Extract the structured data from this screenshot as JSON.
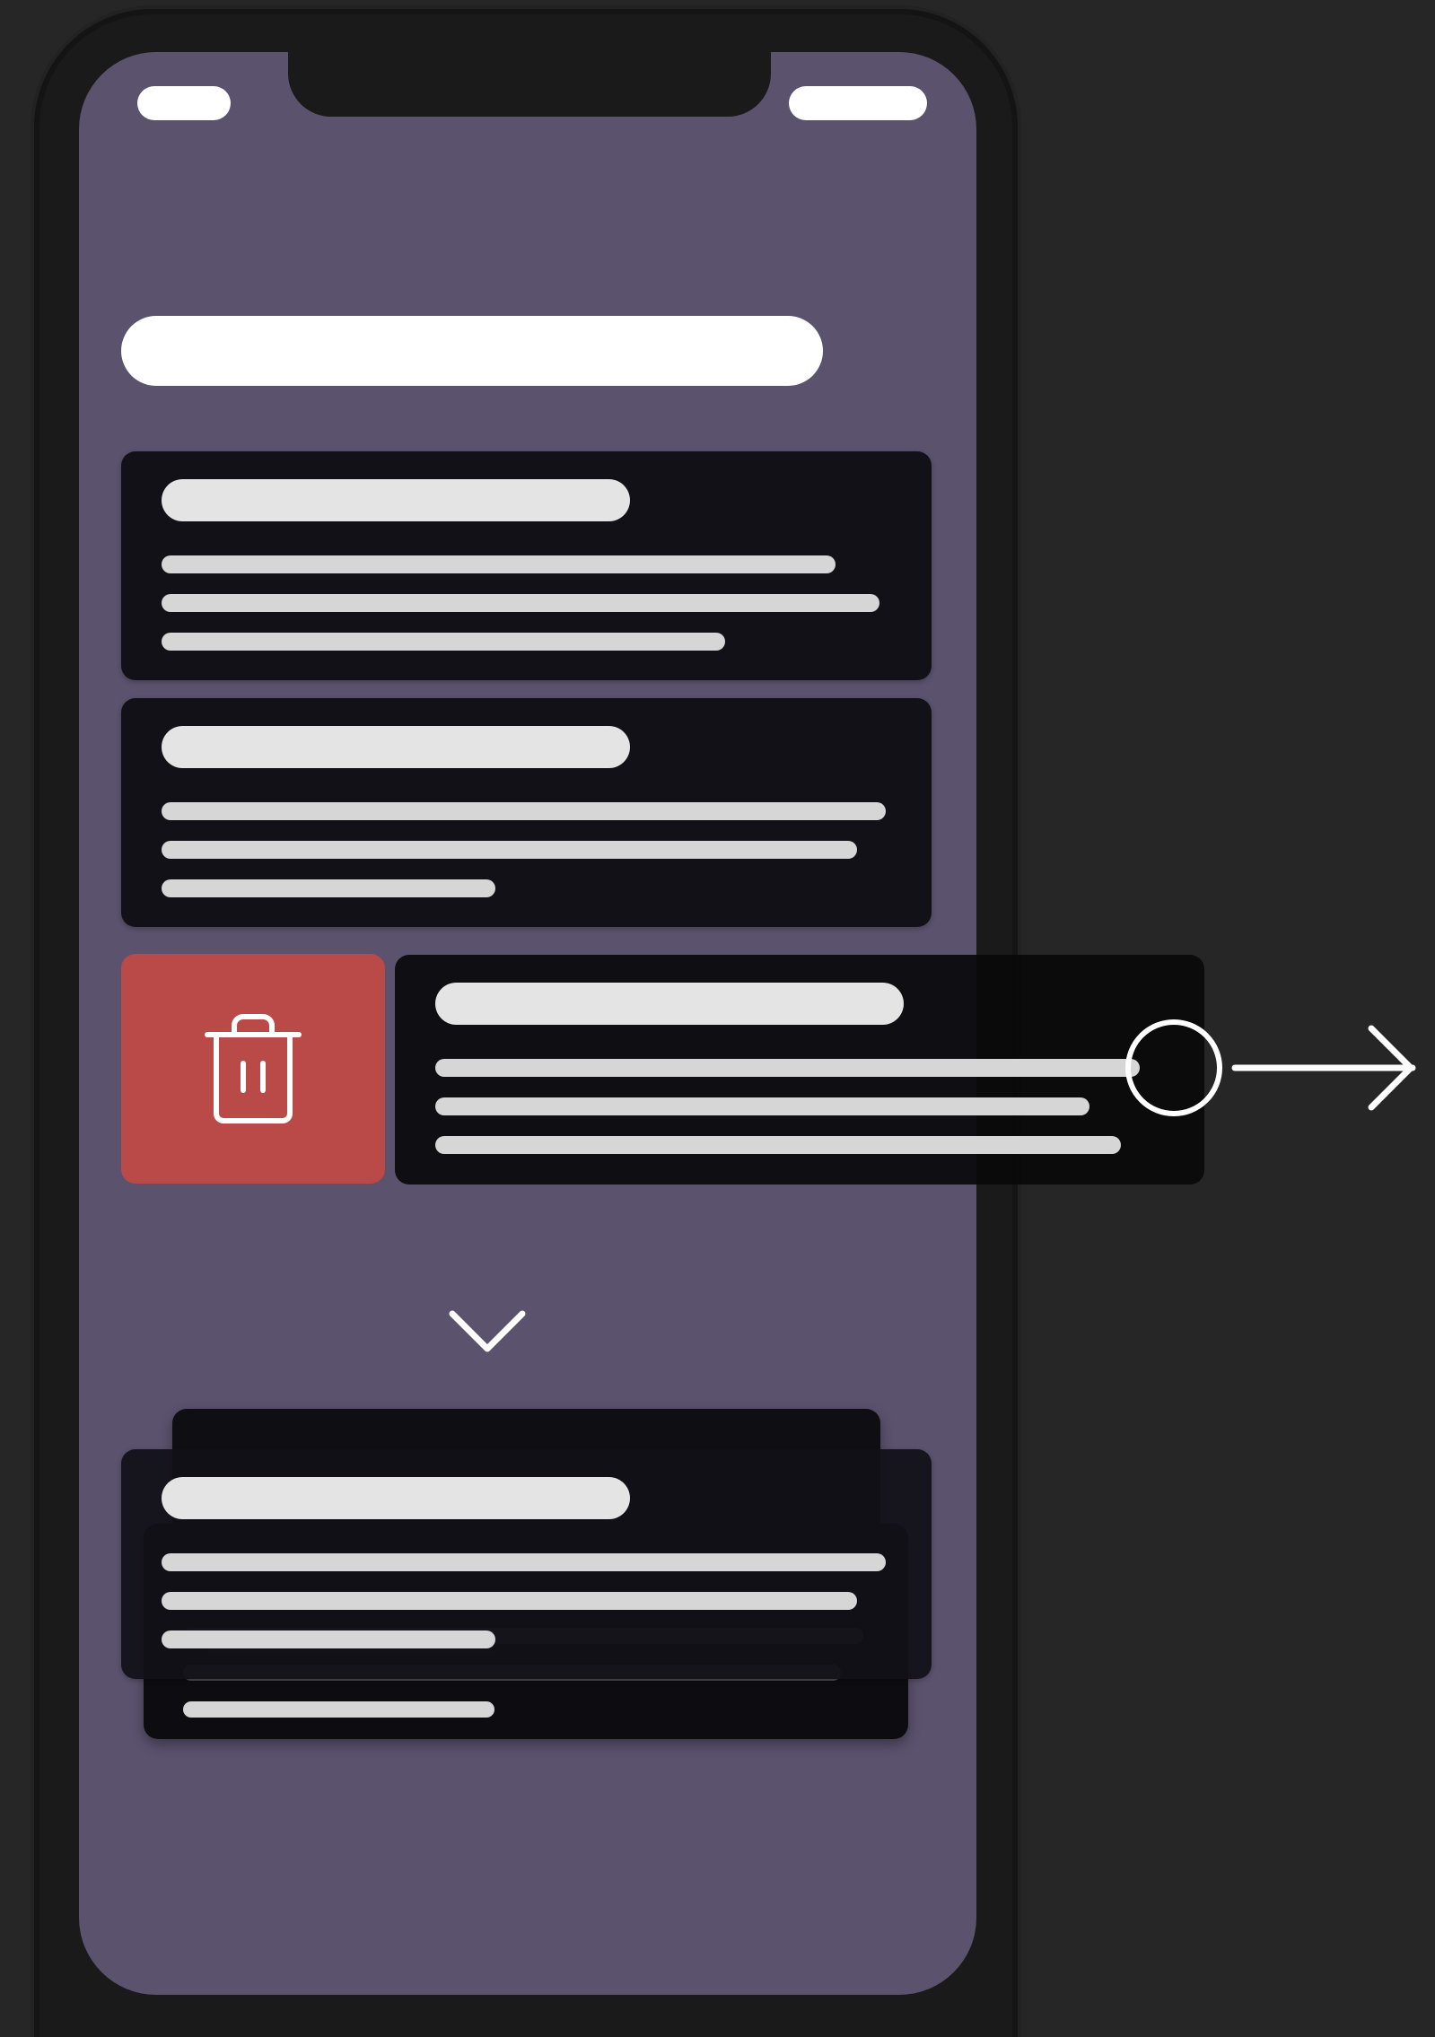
{
  "app": {
    "screen_color": "#5b526e",
    "card_color": "#131118",
    "line_color": "#d6d6d6",
    "delete_color": "#b94a48",
    "accent_white": "#ffffff"
  },
  "status_bar": {
    "left_icon": "status-pill-icon",
    "right_icon": "status-pill-icon"
  },
  "header": {
    "title_icon": "title-placeholder"
  },
  "list": {
    "items": [
      {
        "type": "card",
        "title_icon": "title-placeholder",
        "lines": 3
      },
      {
        "type": "card",
        "title_icon": "title-placeholder",
        "lines": 3
      },
      {
        "type": "swiped-card",
        "title_icon": "title-placeholder",
        "lines": 3,
        "action": "delete"
      }
    ]
  },
  "gesture": {
    "indicator": "swipe-right-arrow-icon",
    "handle": "touch-point-icon",
    "transition": "chevron-down-icon"
  },
  "collapsed_stack": {
    "cards": 3
  },
  "icons": {
    "trash": "trash-icon",
    "chevron": "chevron-down-icon",
    "arrow": "arrow-right-icon"
  }
}
